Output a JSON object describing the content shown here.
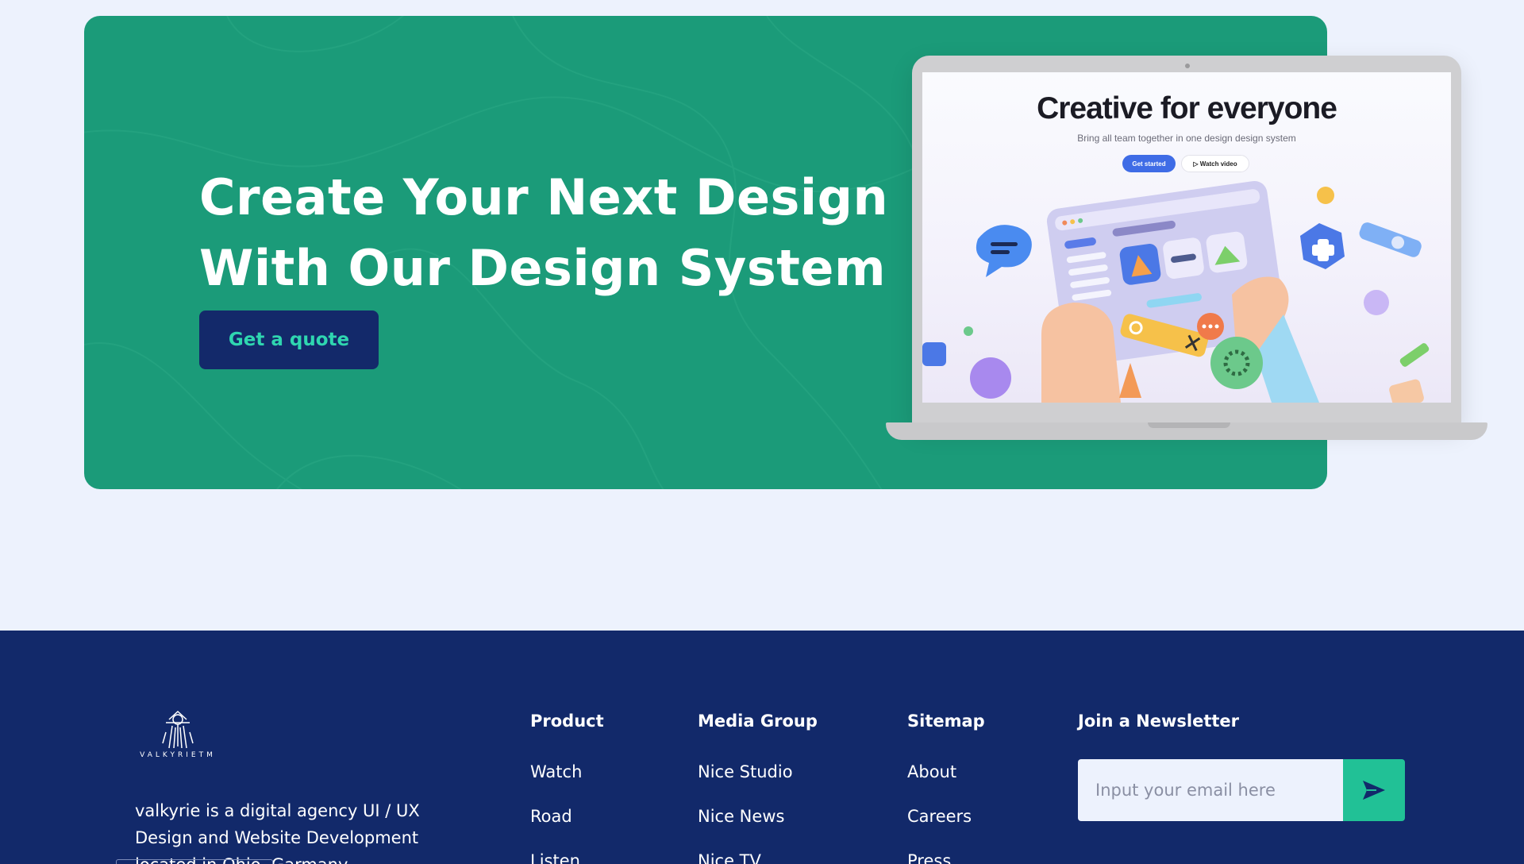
{
  "cta": {
    "title_line1": "Create Your Next Design",
    "title_line2": "With Our Design System",
    "button_label": "Get a quote",
    "background_color": "#1b9b79"
  },
  "mockup": {
    "title": "Creative for everyone",
    "subtitle": "Bring all team together in one design design system",
    "primary_button": "Get started",
    "secondary_button": "Watch video"
  },
  "footer": {
    "logo_text": "VALKYRIETM",
    "about": "valkyrie is a digital agency UI / UX Design and Website Development located in Ohio, Garmany",
    "columns": [
      {
        "heading": "Product",
        "links": [
          "Watch",
          "Road",
          "Listen"
        ]
      },
      {
        "heading": "Media Group",
        "links": [
          "Nice Studio",
          "Nice News",
          "Nice TV"
        ]
      },
      {
        "heading": "Sitemap",
        "links": [
          "About",
          "Careers",
          "Press"
        ]
      }
    ],
    "newsletter": {
      "heading": "Join a Newsletter",
      "placeholder": "Input your email here",
      "submit_icon": "send-icon"
    },
    "background_color": "#12296a",
    "accent_color": "#21c196"
  }
}
